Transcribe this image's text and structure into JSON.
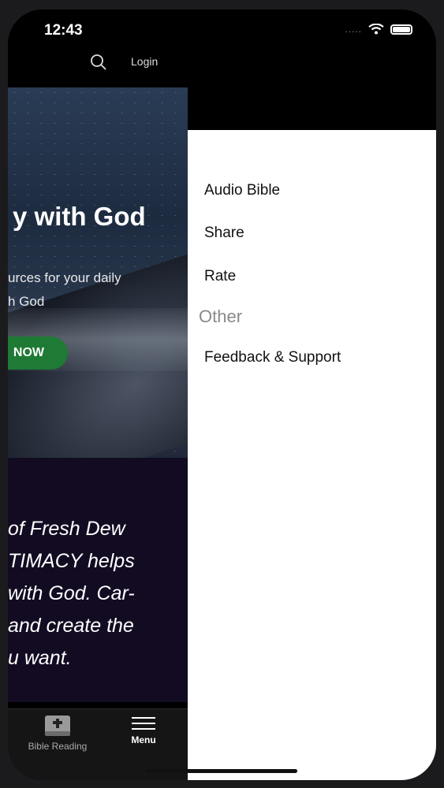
{
  "status": {
    "time": "12:43",
    "cell_dots": "....."
  },
  "header": {
    "login_label": "Login"
  },
  "hero": {
    "title": "y with God",
    "subtitle_line1": "urces for your daily",
    "subtitle_line2": "h God",
    "cta_label": "NOW"
  },
  "quote_lines": [
    "of Fresh Dew",
    "TIMACY helps",
    "with God. Car-",
    "and create the",
    "u want."
  ],
  "tabs": [
    {
      "label": "Bible Reading",
      "icon": "bible-icon"
    },
    {
      "label": "Menu",
      "icon": "menu-icon"
    }
  ],
  "drawer": {
    "items": [
      "Audio Bible",
      "Share",
      "Rate"
    ],
    "section_header": "Other",
    "other_items": [
      "Feedback & Support"
    ]
  },
  "colors": {
    "cta": "#1f7a35",
    "drawer_bg": "#ffffff",
    "section_header": "#8a8a8a"
  }
}
